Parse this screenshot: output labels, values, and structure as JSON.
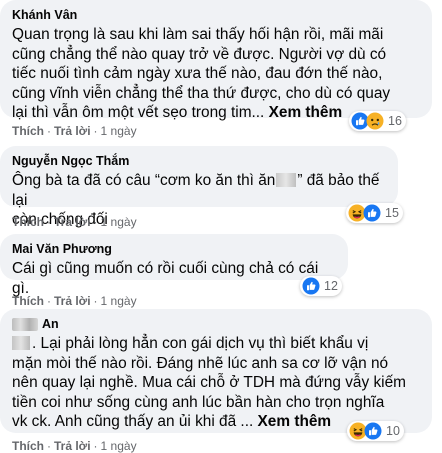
{
  "comments": [
    {
      "author": "Khánh Vân",
      "lines": [
        "Quan trọng là sau khi làm sai thấy hối hận rồi, mãi mãi",
        "cũng chẳng thể nào quay trở về được. Người vợ dù có",
        "tiếc nuối tình cảm ngày xưa thế nào, đau đớn thế nào,",
        "cũng vĩnh viễn chẳng thể tha thứ được, cho dù có quay",
        "lại thì vẫn ôm một vết sẹo trong tim..."
      ],
      "see_more": "Xem thêm",
      "like_label": "Thích",
      "reply_label": "Trả lời",
      "time": "1 ngày",
      "reactions": [
        "like",
        "sad"
      ],
      "reaction_count": "16"
    },
    {
      "author": "Nguyễn Ngọc Thắm",
      "line1_before": "Ông bà ta đã có câu “cơm ko ăn thì ăn",
      "line1_after": "” đã bảo thế lại",
      "line2": "còn chống đối",
      "like_label": "Thích",
      "reply_label": "Trả lời",
      "time": "1 ngày",
      "reactions": [
        "haha",
        "like"
      ],
      "reaction_count": "15"
    },
    {
      "author": "Mai Văn Phương",
      "lines": [
        "Cái gì cũng muốn có rồi cuối cùng chả có cái gì."
      ],
      "like_label": "Thích",
      "reply_label": "Trả lời",
      "time": "1 ngày",
      "reactions": [
        "like"
      ],
      "reaction_count": "12"
    },
    {
      "author": "An",
      "line1": ". Lại phải lòng hẳn con gái dịch vụ thì biết khẩu vị",
      "lines": [
        "mặn mòi thế nào rồi. Đáng nhẽ lúc anh sa cơ lỡ vận nó",
        "nên quay lại nghề. Mua cái chỗ ở TDH mà đứng vẫy kiếm",
        "tiền coi như sống cùng anh lúc bần hàn cho trọn nghĩa",
        "vk ck. Anh cũng thấy an ủi khi đã ..."
      ],
      "see_more": "Xem thêm",
      "like_label": "Thích",
      "reply_label": "Trả lời",
      "time": "1 ngày",
      "reactions": [
        "haha",
        "like"
      ],
      "reaction_count": "10"
    }
  ],
  "colors": {
    "bubble": "#f0f2f5",
    "text": "#050505",
    "meta": "#65676b",
    "like_blue": "#1877f2",
    "react_yellow": "#f7b125"
  }
}
